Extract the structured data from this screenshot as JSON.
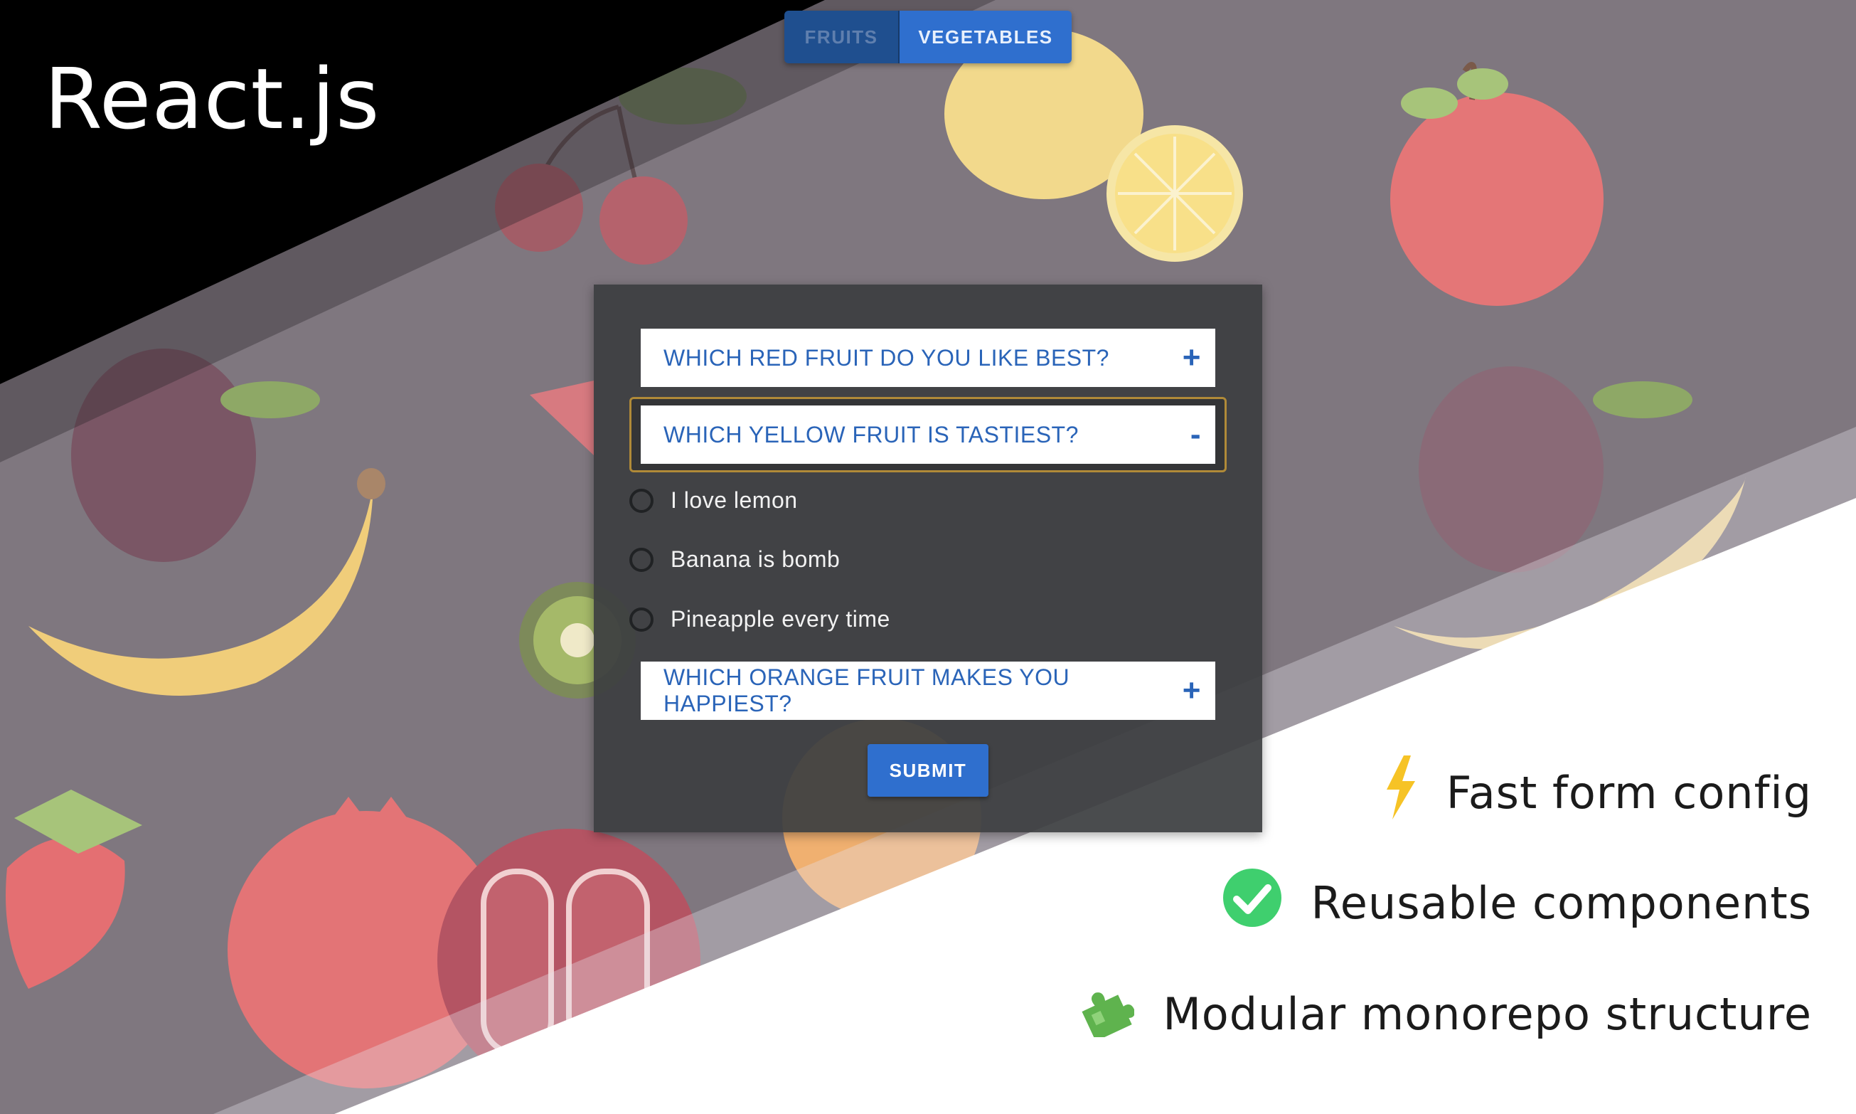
{
  "tabs": [
    {
      "label": "FRUITS",
      "active": false
    },
    {
      "label": "VEGETABLES",
      "active": true
    }
  ],
  "brand": {
    "title": "React.js"
  },
  "form": {
    "questions": [
      {
        "label": "WHICH RED FRUIT DO YOU LIKE BEST?",
        "toggle": "+",
        "expanded": false
      },
      {
        "label": "WHICH YELLOW FRUIT IS TASTIEST?",
        "toggle": "-",
        "expanded": true,
        "options": [
          "I love lemon",
          "Banana is bomb",
          "Pineapple every time"
        ]
      },
      {
        "label": "WHICH ORANGE FRUIT MAKES YOU HAPPIEST?",
        "toggle": "+",
        "expanded": false
      }
    ],
    "submit_label": "SUBMIT"
  },
  "features": [
    {
      "icon": "lightning-icon",
      "text": "Fast form config"
    },
    {
      "icon": "check-circle-icon",
      "text": "Reusable components"
    },
    {
      "icon": "puzzle-piece-icon",
      "text": "Modular monorepo structure"
    }
  ],
  "colors": {
    "accent_blue": "#2f6fce",
    "panel_bg": "#3c3e41",
    "background": "#7f777f",
    "check_green": "#3fcf6e",
    "lightning_yellow": "#f6c326"
  }
}
